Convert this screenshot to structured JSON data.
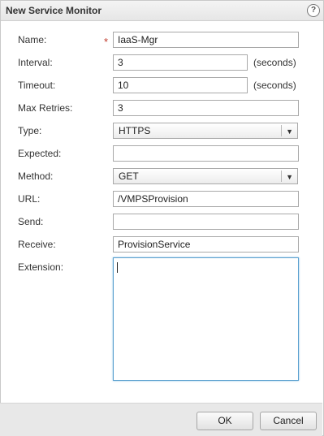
{
  "dialog": {
    "title": "New Service Monitor",
    "help_glyph": "?"
  },
  "form": {
    "name": {
      "label": "Name:",
      "value": "IaaS-Mgr",
      "required_marker": "*"
    },
    "interval": {
      "label": "Interval:",
      "value": "3",
      "unit": "(seconds)"
    },
    "timeout": {
      "label": "Timeout:",
      "value": "10",
      "unit": "(seconds)"
    },
    "max_retries": {
      "label": "Max Retries:",
      "value": "3"
    },
    "type": {
      "label": "Type:",
      "value": "HTTPS"
    },
    "expected": {
      "label": "Expected:",
      "value": ""
    },
    "method": {
      "label": "Method:",
      "value": "GET"
    },
    "url": {
      "label": "URL:",
      "value": "/VMPSProvision"
    },
    "send": {
      "label": "Send:",
      "value": ""
    },
    "receive": {
      "label": "Receive:",
      "value": "ProvisionService"
    },
    "extension": {
      "label": "Extension:",
      "value": ""
    }
  },
  "footer": {
    "ok_label": "OK",
    "cancel_label": "Cancel"
  }
}
